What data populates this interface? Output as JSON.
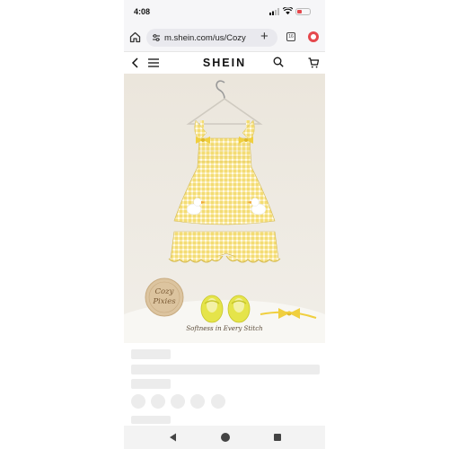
{
  "status_bar": {
    "time": "4:08"
  },
  "browser": {
    "url": "m.shein.com/us/Cozy",
    "tab_count": "16"
  },
  "site": {
    "logo": "SHEIN"
  },
  "product_image": {
    "badge_line1": "Cozy",
    "badge_line2": "Pixies",
    "tagline": "Softness in Every Stitch"
  },
  "colors": {
    "accent": "#e5484d",
    "garment": "#f2d86a",
    "background": "#eae6dd"
  },
  "icons": [
    "home-icon",
    "tune-icon",
    "plus-icon",
    "tabs-icon",
    "opera-icon",
    "back-icon",
    "menu-icon",
    "search-icon",
    "cart-icon"
  ]
}
